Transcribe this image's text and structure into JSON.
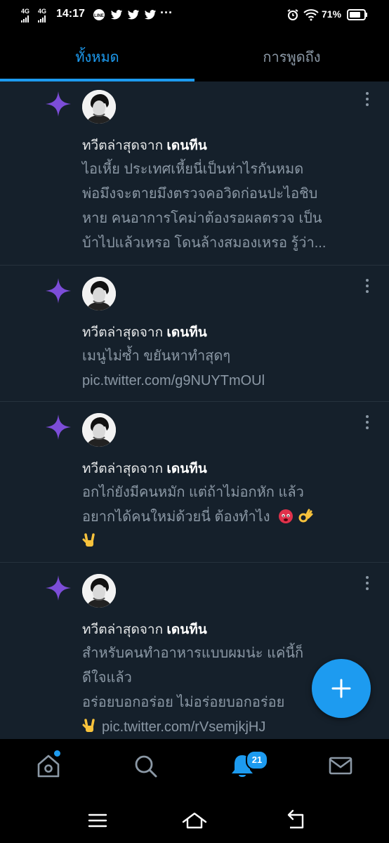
{
  "status_bar": {
    "net1": "4G",
    "net2": "4G",
    "time": "14:17",
    "line_label": "LINE",
    "more": "···",
    "battery": "71%"
  },
  "tabs": {
    "all": "ทั้งหมด",
    "mentions": "การพูดถึง"
  },
  "feed": [
    {
      "header_prefix": "ทวีตล่าสุดจาก",
      "author": "เดนทีน",
      "lines": [
        "ไอเหี้ย ประเทศเหี้ยนี่เป็นห่าไรกันหมด",
        "พ่อมึงจะตายมึงตรวจคอวิดก่อนปะไอชิบ",
        "หาย คนอาการโคม่าต้องรอผลตรวจ เป็น",
        "บ้าไปแล้วเหรอ โดนล้างสมองเหรอ รู้ว่า..."
      ]
    },
    {
      "header_prefix": "ทวีตล่าสุดจาก",
      "author": "เดนทีน",
      "lines": [
        "เมนูไม่ซ้ำ ขยันหาทำสุดๆ",
        "pic.twitter.com/g9NUYTmOUl"
      ]
    },
    {
      "header_prefix": "ทวีตล่าสุดจาก",
      "author": "เดนทีน",
      "lines": [
        "อกไก่ยังมีคนหมัก แต่ถ้าไม่อกหัก แล้ว",
        "อยากได้คนใหม่ด้วยนี่ ต้องทำไง"
      ]
    },
    {
      "header_prefix": "ทวีตล่าสุดจาก",
      "author": "เดนทีน",
      "lines": [
        "สำหรับคนทำอาหารแบบผมน่ะ แค่นี้ก็",
        "ดีใจแล้ว",
        "อร่อยบอกอร่อย ไม่อร่อยบอกอร่อย",
        "pic.twitter.com/rVsemjkjHJ"
      ]
    }
  ],
  "nav": {
    "notifications_badge": "21"
  },
  "icons": {
    "spark": "sparkle-icon",
    "compose": "plus-icon",
    "home": "home-icon",
    "search": "search-icon",
    "notifications": "bell-icon",
    "messages": "mail-icon"
  },
  "colors": {
    "accent": "#1d9bf0",
    "spark": "#7c4dd8",
    "background": "#15202b"
  }
}
